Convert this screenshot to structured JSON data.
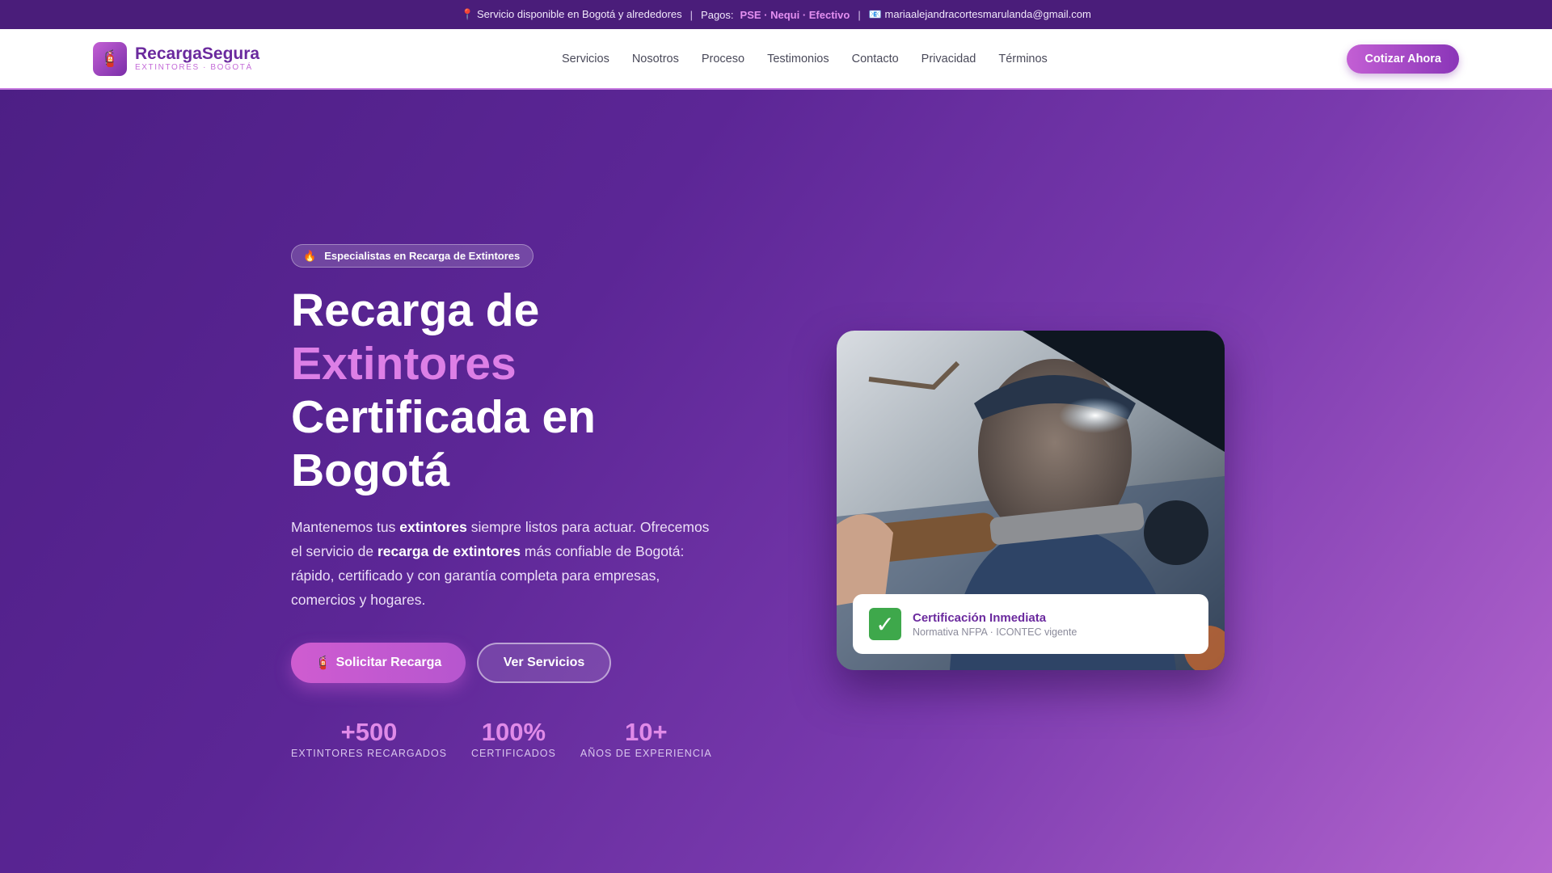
{
  "topbar": {
    "location": "📍 Servicio disponible en Bogotá y alrededores",
    "payments_label": "Pagos:",
    "payments_methods": "PSE · Nequi · Efectivo",
    "email": "📧 mariaalejandracortesmarulanda@gmail.com"
  },
  "nav": {
    "brand_icon": "🧯",
    "brand_name": "RecargaSegura",
    "brand_sub": "EXTINTORES · BOGOTÁ",
    "items": [
      {
        "label": "Servicios"
      },
      {
        "label": "Nosotros"
      },
      {
        "label": "Proceso"
      },
      {
        "label": "Testimonios"
      },
      {
        "label": "Contacto"
      },
      {
        "label": "Privacidad"
      },
      {
        "label": "Términos"
      }
    ],
    "cta": "Cotizar Ahora"
  },
  "hero": {
    "pill_icon": "🔥",
    "pill_text": "Especialistas en Recarga de Extintores",
    "title_line1": "Recarga de",
    "title_highlight": "Extintores",
    "title_line3": "Certificada en",
    "title_line4": "Bogotá",
    "desc_1": "Mantenemos tus ",
    "desc_b1": "extintores",
    "desc_2": " siempre listos para actuar. Ofrecemos el servicio de ",
    "desc_b2": "recarga de extintores",
    "desc_3": " más confiable de Bogotá: rápido, certificado y con garantía completa para empresas, comercios y hogares.",
    "btn_primary_icon": "🧯",
    "btn_primary": "Solicitar Recarga",
    "btn_secondary": "Ver Servicios",
    "stats": [
      {
        "num": "+500",
        "label": "EXTINTORES RECARGADOS"
      },
      {
        "num": "100%",
        "label": "CERTIFICADOS"
      },
      {
        "num": "10+",
        "label": "AÑOS DE EXPERIENCIA"
      }
    ]
  },
  "card": {
    "check_icon": "✓",
    "badge_title": "Certificación Inmediata",
    "badge_sub": "Normativa NFPA · ICONTEC vigente"
  },
  "colors": {
    "brand": "#6b2a9e",
    "accent": "#dd7fe6",
    "topbar_bg": "#4a1d7a",
    "check_green": "#3ea84b"
  }
}
